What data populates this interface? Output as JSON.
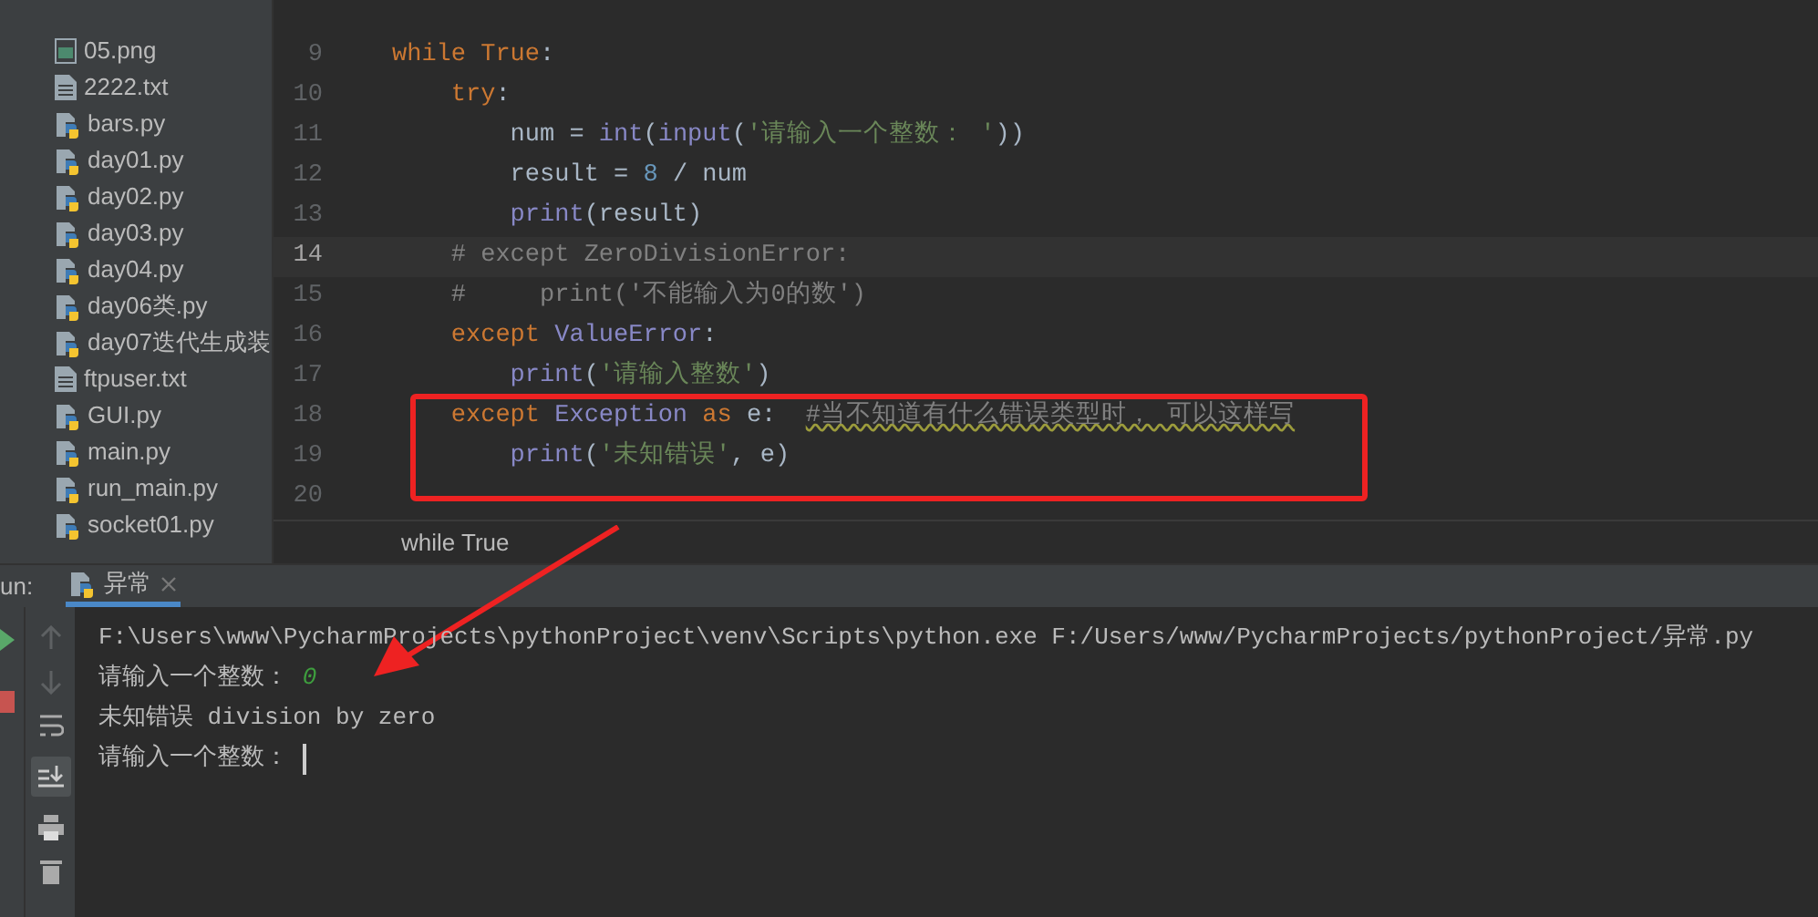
{
  "project_tree": {
    "items": [
      {
        "name": "05.png",
        "kind": "image",
        "selected": false
      },
      {
        "name": "2222.txt",
        "kind": "text",
        "selected": false
      },
      {
        "name": "bars.py",
        "kind": "python",
        "selected": false
      },
      {
        "name": "day01.py",
        "kind": "python",
        "selected": false
      },
      {
        "name": "day02.py",
        "kind": "python",
        "selected": false
      },
      {
        "name": "day03.py",
        "kind": "python",
        "selected": false
      },
      {
        "name": "day04.py",
        "kind": "python",
        "selected": false
      },
      {
        "name": "day06类.py",
        "kind": "python",
        "selected": false
      },
      {
        "name": "day07迭代生成装",
        "kind": "python",
        "selected": false
      },
      {
        "name": "ftpuser.txt",
        "kind": "text",
        "selected": false
      },
      {
        "name": "GUI.py",
        "kind": "python",
        "selected": false
      },
      {
        "name": "main.py",
        "kind": "python",
        "selected": false
      },
      {
        "name": "run_main.py",
        "kind": "python",
        "selected": false
      },
      {
        "name": "socket01.py",
        "kind": "python",
        "selected": false
      }
    ]
  },
  "editor": {
    "lines": [
      {
        "number": "9",
        "current": false,
        "tokens": [
          {
            "t": "while ",
            "kind": "keyword"
          },
          {
            "t": "True",
            "kind": "keyword"
          },
          {
            "t": ":",
            "kind": "plain"
          }
        ]
      },
      {
        "number": "10",
        "current": false,
        "tokens": [
          {
            "t": "    try",
            "kind": "keyword"
          },
          {
            "t": ":",
            "kind": "plain"
          }
        ]
      },
      {
        "number": "11",
        "current": false,
        "tokens": [
          {
            "t": "        num = ",
            "kind": "plain"
          },
          {
            "t": "int",
            "kind": "builtin"
          },
          {
            "t": "(",
            "kind": "plain"
          },
          {
            "t": "input",
            "kind": "builtin"
          },
          {
            "t": "(",
            "kind": "plain"
          },
          {
            "t": "'请输入一个整数： '",
            "kind": "string"
          },
          {
            "t": "))",
            "kind": "plain"
          }
        ]
      },
      {
        "number": "12",
        "current": false,
        "tokens": [
          {
            "t": "        result = ",
            "kind": "plain"
          },
          {
            "t": "8",
            "kind": "number"
          },
          {
            "t": " / num",
            "kind": "plain"
          }
        ]
      },
      {
        "number": "13",
        "current": false,
        "tokens": [
          {
            "t": "        print",
            "kind": "builtin"
          },
          {
            "t": "(result)",
            "kind": "plain"
          }
        ]
      },
      {
        "number": "14",
        "current": true,
        "tokens": [
          {
            "t": "    # except ZeroDivisionError:",
            "kind": "comment"
          }
        ]
      },
      {
        "number": "15",
        "current": false,
        "tokens": [
          {
            "t": "    #     print('不能输入为0的数')",
            "kind": "comment"
          }
        ]
      },
      {
        "number": "16",
        "current": false,
        "tokens": [
          {
            "t": "    except ",
            "kind": "keyword"
          },
          {
            "t": "ValueError",
            "kind": "builtin"
          },
          {
            "t": ":",
            "kind": "plain"
          }
        ]
      },
      {
        "number": "17",
        "current": false,
        "tokens": [
          {
            "t": "        print",
            "kind": "builtin"
          },
          {
            "t": "(",
            "kind": "plain"
          },
          {
            "t": "'请输入整数'",
            "kind": "string"
          },
          {
            "t": ")",
            "kind": "plain"
          }
        ]
      },
      {
        "number": "18",
        "current": false,
        "tokens": [
          {
            "t": "    except ",
            "kind": "keyword"
          },
          {
            "t": "Exception ",
            "kind": "builtin"
          },
          {
            "t": "as ",
            "kind": "keyword"
          },
          {
            "t": "e:  ",
            "kind": "plain"
          },
          {
            "t": "#当不知道有什么错误类型时， 可以这样写",
            "kind": "warn_comment"
          }
        ]
      },
      {
        "number": "19",
        "current": false,
        "tokens": [
          {
            "t": "        print",
            "kind": "builtin"
          },
          {
            "t": "(",
            "kind": "plain"
          },
          {
            "t": "'未知错误'",
            "kind": "string"
          },
          {
            "t": ", e)",
            "kind": "plain"
          }
        ]
      },
      {
        "number": "20",
        "current": false
      }
    ],
    "breadcrumb": "while True"
  },
  "run_panel": {
    "label": "un:",
    "tabs": [
      {
        "label": "异常",
        "selected": true
      }
    ],
    "console": [
      {
        "kind": "output",
        "text": "F:\\Users\\www\\PycharmProjects\\pythonProject\\venv\\Scripts\\python.exe F:/Users/www/PycharmProjects/pythonProject/异常.py"
      },
      {
        "kind": "prompt",
        "text": "请输入一个整数： ",
        "input": "0"
      },
      {
        "kind": "output",
        "text": "未知错误 division by zero"
      },
      {
        "kind": "prompt",
        "text": "请输入一个整数： ",
        "cursor": true
      }
    ]
  }
}
